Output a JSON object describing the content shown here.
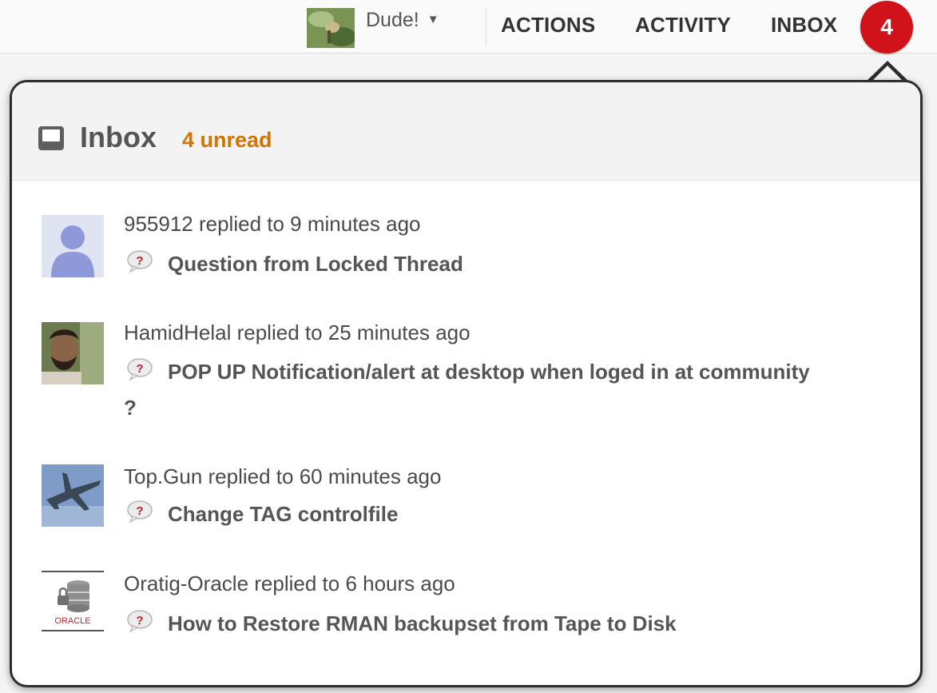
{
  "topbar": {
    "user_name": "Dude!",
    "nav": {
      "actions": "ACTIONS",
      "activity": "ACTIVITY",
      "inbox": "INBOX"
    },
    "inbox_badge": "4",
    "badge_color": "#d0131b"
  },
  "popover": {
    "title": "Inbox",
    "unread": "4 unread",
    "unread_color": "#d47400",
    "icon": "inbox-tray-icon"
  },
  "notifications": [
    {
      "meta": "955912 replied to 9 minutes ago",
      "title": "Question from Locked Thread",
      "avatar": "default-person-avatar",
      "icon": "question-icon"
    },
    {
      "meta": "HamidHelal replied to 25 minutes ago",
      "title": "POP UP Notification/alert at desktop when loged in at community ?",
      "avatar": "photo-avatar",
      "icon": "question-icon"
    },
    {
      "meta": "Top.Gun replied to 60 minutes ago",
      "title": "Change TAG controlfile",
      "avatar": "jet-avatar",
      "icon": "question-icon"
    },
    {
      "meta": "Oratig-Oracle replied to 6 hours ago",
      "title": "How to Restore RMAN backupset from Tape to Disk",
      "avatar": "oracle-db-avatar",
      "avatar_label": "ORACLE",
      "icon": "question-icon"
    }
  ]
}
